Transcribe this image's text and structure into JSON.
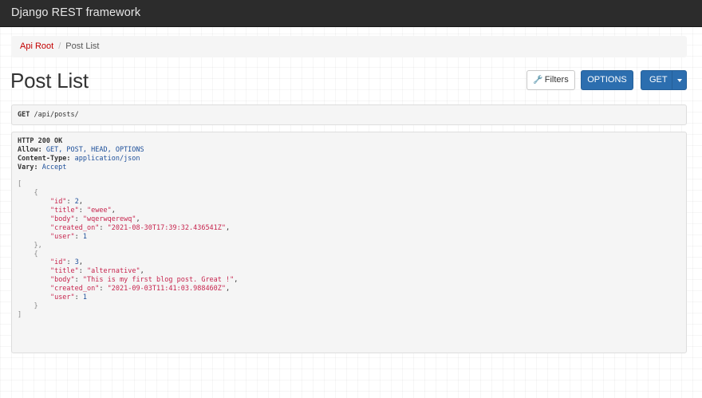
{
  "navbar": {
    "brand": "Django REST framework"
  },
  "breadcrumb": {
    "root": "Api Root",
    "separator": "/",
    "current": "Post List"
  },
  "page": {
    "title": "Post List"
  },
  "buttons": {
    "filters": "Filters",
    "options": "OPTIONS",
    "get": "GET"
  },
  "request": {
    "method": "GET",
    "path": " /api/posts/"
  },
  "response": {
    "status": "HTTP 200 OK",
    "headers": [
      {
        "name": "Allow:",
        "value": " GET, POST, HEAD, OPTIONS"
      },
      {
        "name": "Content-Type:",
        "value": " application/json"
      },
      {
        "name": "Vary:",
        "value": " Accept"
      }
    ],
    "posts": [
      {
        "id": "2",
        "title": "\"ewee\"",
        "body": "\"wqerwqerewq\"",
        "created_on": "\"2021-08-30T17:39:32.436541Z\"",
        "user": "1"
      },
      {
        "id": "3",
        "title": "\"alternative\"",
        "body": "\"This is my first blog post. Great !\"",
        "created_on": "\"2021-09-03T11:41:03.988460Z\"",
        "user": "1"
      }
    ]
  },
  "icons": {
    "filters": "wrench-icon",
    "get_dropdown": "caret-down-icon"
  },
  "colors": {
    "navbar": "#2c2c2c",
    "primary_button": "#2c6eaf",
    "link": "#c20000",
    "json_string": "#c7254e",
    "json_number": "#1d4f9a"
  }
}
